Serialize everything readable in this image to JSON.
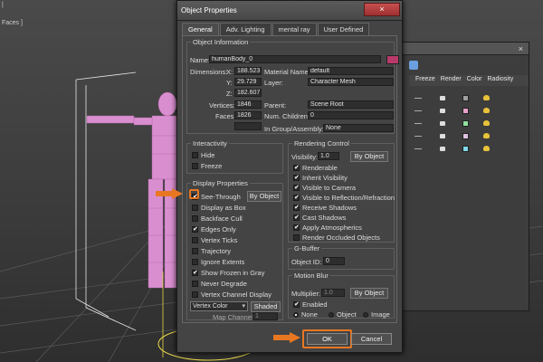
{
  "viewport": {
    "label_top": "|",
    "label_faces": "Faces ]"
  },
  "bg_window": {
    "close": "×",
    "columns": [
      "Freeze",
      "Render",
      "Color",
      "Radiosity"
    ],
    "rows": [
      {
        "color": "#a0a0a0"
      },
      {
        "color": "#e6a0c8"
      },
      {
        "color": "#90e0a0"
      },
      {
        "color": "#e0c0e0"
      },
      {
        "color": "#80d8e8"
      }
    ]
  },
  "dialog": {
    "title": "Object Properties",
    "close": "×",
    "tabs": [
      "General",
      "Adv. Lighting",
      "mental ray",
      "User Defined"
    ],
    "object_info": {
      "label": "Object Information",
      "name_label": "Name:",
      "name_value": "humanBody_0",
      "swatch_color": "#b83a6a",
      "dimensions_label": "Dimensions:",
      "x_label": "X:",
      "x_value": "188.523",
      "y_label": "Y:",
      "y_value": "29.729",
      "z_label": "Z:",
      "z_value": "182.607",
      "material_label": "Material Name:",
      "material_value": "default",
      "layer_label": "Layer:",
      "layer_value": "Character Mesh",
      "vertices_label": "Vertices:",
      "vertices_value": "1846",
      "faces_label": "Faces:",
      "faces_value": "1826",
      "parent_label": "Parent:",
      "parent_value": "Scene Root",
      "children_label": "Num. Children:",
      "children_value": "0",
      "group_label": "In Group/Assembly:",
      "group_value": "None"
    },
    "interactivity": {
      "label": "Interactivity",
      "hide": "Hide",
      "freeze": "Freeze"
    },
    "display": {
      "label": "Display Properties",
      "by_object": "By Object",
      "see_through": "See-Through",
      "display_as_box": "Display as Box",
      "backface_cull": "Backface Cull",
      "edges_only": "Edges Only",
      "vertex_ticks": "Vertex Ticks",
      "trajectory": "Trajectory",
      "ignore_extents": "Ignore Extents",
      "show_frozen": "Show Frozen in Gray",
      "never_degrade": "Never Degrade",
      "vertex_channel": "Vertex Channel Display",
      "vertex_color": "Vertex Color",
      "shaded": "Shaded",
      "map_channel_label": "Map Channel:",
      "map_channel_value": "1"
    },
    "rendering": {
      "label": "Rendering Control",
      "visibility_label": "Visibility:",
      "visibility_value": "1.0",
      "by_object": "By Object",
      "renderable": "Renderable",
      "inherit_visibility": "Inherit Visibility",
      "visible_camera": "Visible to Camera",
      "visible_reflection": "Visible to Reflection/Refraction",
      "receive_shadows": "Receive Shadows",
      "cast_shadows": "Cast Shadows",
      "apply_atmospherics": "Apply Atmospherics",
      "render_occluded": "Render Occluded Objects"
    },
    "gbuffer": {
      "label": "G-Buffer",
      "object_id_label": "Object ID:",
      "object_id_value": "0"
    },
    "motion_blur": {
      "label": "Motion Blur",
      "multiplier_label": "Multiplier:",
      "multiplier_value": "1.0",
      "by_object": "By Object",
      "enabled": "Enabled",
      "none": "None",
      "object": "Object",
      "image": "Image"
    },
    "ok": "OK",
    "cancel": "Cancel",
    "highlight_color": "#e87722"
  }
}
